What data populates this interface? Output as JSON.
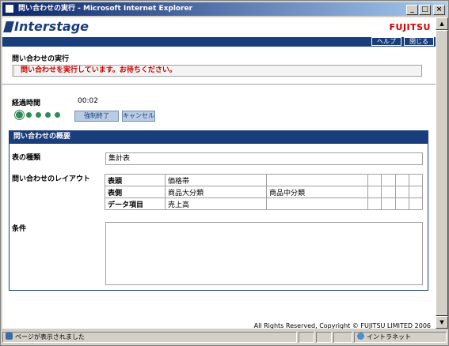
{
  "window": {
    "title": "問い合わせの実行 - Microsoft Internet Explorer",
    "min_label": "_",
    "max_label": "□",
    "close_label": "×"
  },
  "header": {
    "logo_text": "Interstage",
    "brand_text": "FUJITSU",
    "help_label": "ヘルプ",
    "close_label": "閉じる"
  },
  "page": {
    "title": "問い合わせの実行",
    "status_message": "問い合わせを実行しています。お待ちください。"
  },
  "progress": {
    "elapsed_label": "経過時間",
    "elapsed_value": "00:02",
    "dot_count": 5,
    "active_dot": 0,
    "force_stop_label": "強制終了",
    "cancel_label": "キャンセル"
  },
  "summary": {
    "heading": "問い合わせの概要",
    "table_type_label": "表の種類",
    "table_type_value": "集計表",
    "layout_label": "問い合わせのレイアウト",
    "layout_rows": [
      {
        "header": "表頭",
        "cells": [
          "価格帯",
          "",
          "",
          "",
          "",
          ""
        ]
      },
      {
        "header": "表側",
        "cells": [
          "商品大分類",
          "商品中分類",
          "",
          "",
          "",
          ""
        ]
      },
      {
        "header": "データ項目",
        "cells": [
          "売上高",
          "",
          "",
          "",
          "",
          ""
        ]
      }
    ],
    "condition_label": "条件",
    "condition_value": ""
  },
  "footer": {
    "copyright": "All Rights Reserved, Copyright © FUJITSU LIMITED 2006"
  },
  "statusbar": {
    "message": "ページが表示されました",
    "zone": "イントラネット"
  },
  "colors": {
    "navy": "#1a3d7c",
    "alert_red": "#cc0000",
    "dot_green": "#2e8b57"
  }
}
